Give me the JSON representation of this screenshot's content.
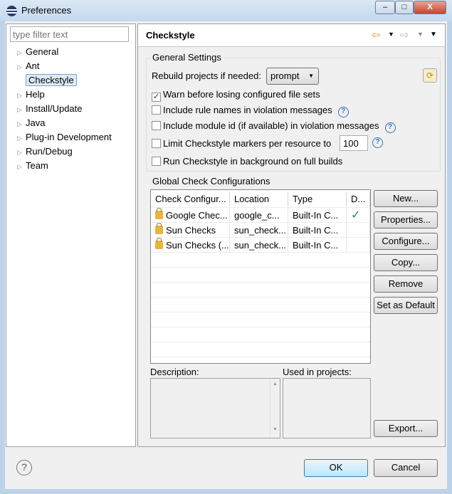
{
  "window": {
    "title": "Preferences",
    "min": "–",
    "max": "□",
    "close": "X"
  },
  "sidebar": {
    "filter_placeholder": "type filter text",
    "items": [
      {
        "label": "General",
        "expandable": true
      },
      {
        "label": "Ant",
        "expandable": true
      },
      {
        "label": "Checkstyle",
        "expandable": false,
        "selected": true
      },
      {
        "label": "Help",
        "expandable": true
      },
      {
        "label": "Install/Update",
        "expandable": true
      },
      {
        "label": "Java",
        "expandable": true
      },
      {
        "label": "Plug-in Development",
        "expandable": true
      },
      {
        "label": "Run/Debug",
        "expandable": true
      },
      {
        "label": "Team",
        "expandable": true
      }
    ]
  },
  "page": {
    "title": "Checkstyle",
    "general": {
      "label": "General Settings",
      "rebuild_label": "Rebuild projects if needed:",
      "rebuild_value": "prompt",
      "warn": {
        "label": "Warn before losing configured file sets",
        "checked": true
      },
      "rule_names": {
        "label": "Include rule names in violation messages",
        "checked": false
      },
      "module_id": {
        "label": "Include module id (if available) in violation messages",
        "checked": false
      },
      "limit": {
        "label": "Limit Checkstyle markers per resource to",
        "checked": false,
        "value": "100"
      },
      "background": {
        "label": "Run Checkstyle in background on full builds",
        "checked": false
      }
    },
    "global": {
      "label": "Global Check Configurations",
      "columns": [
        "Check Configur...",
        "Location",
        "Type",
        "D..."
      ],
      "rows": [
        [
          "Google Chec...",
          "google_c...",
          "Built-In C...",
          "✓"
        ],
        [
          "Sun Checks",
          "sun_check...",
          "Built-In C...",
          ""
        ],
        [
          "Sun Checks (...",
          "sun_check...",
          "Built-In C...",
          ""
        ]
      ],
      "buttons": {
        "new": "New...",
        "properties": "Properties...",
        "configure": "Configure...",
        "copy": "Copy...",
        "remove": "Remove",
        "default": "Set as Default",
        "export": "Export..."
      },
      "description_label": "Description:",
      "used_label": "Used in projects:"
    }
  },
  "footer": {
    "ok": "OK",
    "cancel": "Cancel",
    "help": "?"
  },
  "colors": {
    "accent": "#3a6fc4",
    "check": "#2e8b3a"
  }
}
